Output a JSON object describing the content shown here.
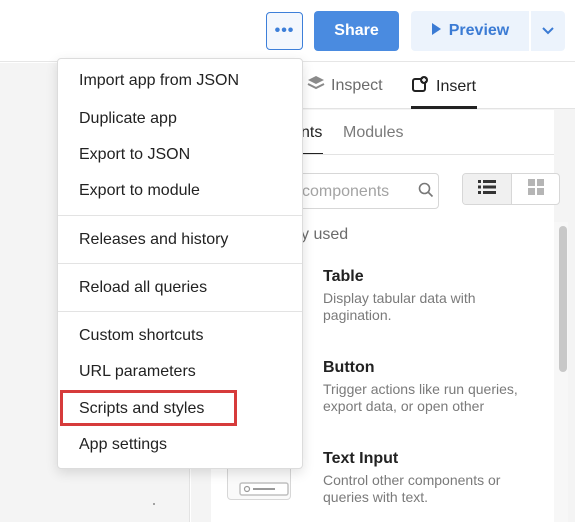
{
  "topbar": {
    "more_label": "•••",
    "share_label": "Share",
    "preview_label": "Preview"
  },
  "panel": {
    "tabs": {
      "inspect": "Inspect",
      "insert": "Insert"
    },
    "subtabs": {
      "components": "nts",
      "modules": "Modules"
    },
    "search": {
      "placeholder": "components"
    },
    "section_label": "y used",
    "components": [
      {
        "title": "Table",
        "description_1": "Display tabular data with",
        "description_2": "pagination."
      },
      {
        "title": "Button",
        "description_1": "Trigger actions like run queries,",
        "description_2": "export data, or open other"
      },
      {
        "title": "Text Input",
        "description_1": "Control other components or",
        "description_2": "queries with text."
      }
    ]
  },
  "menu": {
    "items": [
      "Import app from JSON",
      "Duplicate app",
      "Export to JSON",
      "Export to module",
      "Releases and history",
      "Reload all queries",
      "Custom shortcuts",
      "URL parameters",
      "Scripts and styles",
      "App settings"
    ]
  },
  "colors": {
    "accent": "#4a8be0",
    "highlight": "#d63b3b"
  }
}
